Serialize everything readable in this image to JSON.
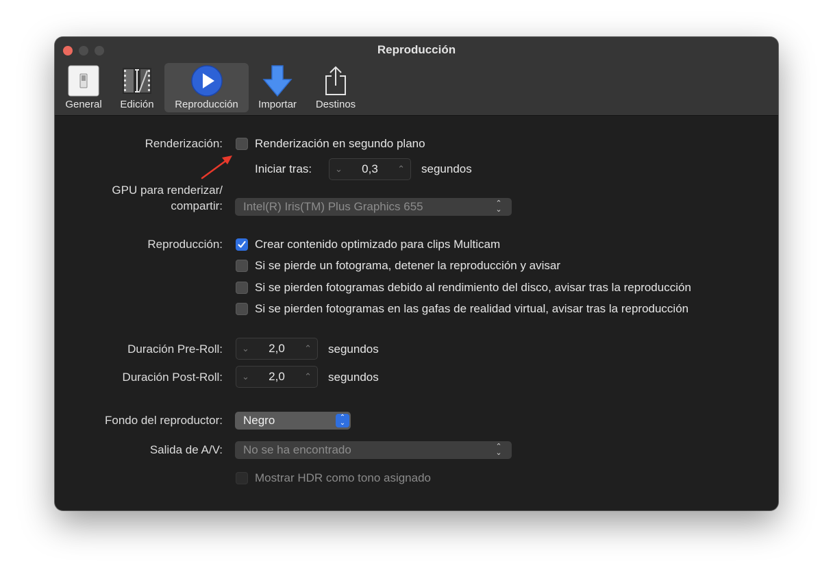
{
  "window": {
    "title": "Reproducción"
  },
  "toolbar": {
    "items": [
      {
        "label": "General",
        "icon": "switch-icon"
      },
      {
        "label": "Edición",
        "icon": "film-edit-icon"
      },
      {
        "label": "Reproducción",
        "icon": "play-icon",
        "selected": true
      },
      {
        "label": "Importar",
        "icon": "download-arrow-icon"
      },
      {
        "label": "Destinos",
        "icon": "share-icon"
      }
    ]
  },
  "render": {
    "label": "Renderización:",
    "checkbox_label": "Renderización en segundo plano",
    "checked": false,
    "delay_label": "Iniciar tras:",
    "delay_value": "0,3",
    "delay_unit": "segundos"
  },
  "gpu": {
    "label_line1": "GPU para renderizar/",
    "label_line2": "compartir:",
    "value": "Intel(R) Iris(TM) Plus Graphics 655"
  },
  "playback": {
    "label": "Reproducción:",
    "options": [
      {
        "label": "Crear contenido optimizado para clips Multicam",
        "checked": true
      },
      {
        "label": "Si se pierde un fotograma, detener la reproducción y avisar",
        "checked": false
      },
      {
        "label": "Si se pierden fotogramas debido al rendimiento del disco, avisar tras la reproducción",
        "checked": false
      },
      {
        "label": "Si se pierden fotogramas en las gafas de realidad virtual, avisar tras la reproducción",
        "checked": false
      }
    ]
  },
  "preroll": {
    "label": "Duración Pre-Roll:",
    "value": "2,0",
    "unit": "segundos"
  },
  "postroll": {
    "label": "Duración Post-Roll:",
    "value": "2,0",
    "unit": "segundos"
  },
  "background": {
    "label": "Fondo del reproductor:",
    "value": "Negro"
  },
  "av_output": {
    "label": "Salida de A/V:",
    "value": "No se ha encontrado"
  },
  "hdr": {
    "label": "Mostrar HDR como tono asignado",
    "checked": false,
    "enabled": false
  },
  "colors": {
    "accent": "#2f6fe0",
    "annotation_arrow": "#e8392b"
  }
}
